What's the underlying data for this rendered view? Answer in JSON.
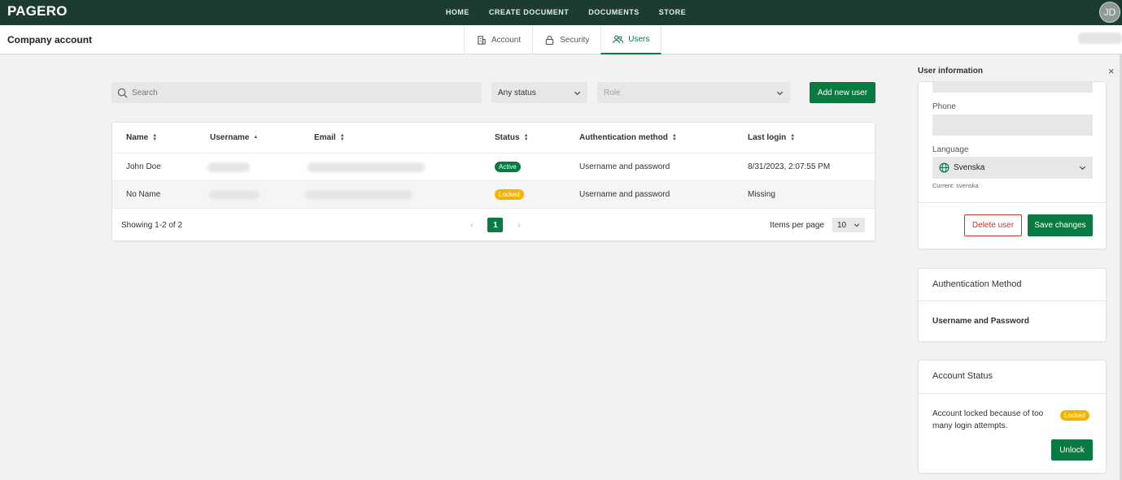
{
  "app": {
    "logo": "PAGERO",
    "avatar_initials": "JD"
  },
  "nav": {
    "items": [
      "HOME",
      "CREATE DOCUMENT",
      "DOCUMENTS",
      "STORE"
    ]
  },
  "subheader": {
    "title": "Company account",
    "tabs": [
      {
        "label": "Account",
        "icon": "building-icon"
      },
      {
        "label": "Security",
        "icon": "lock-icon"
      },
      {
        "label": "Users",
        "icon": "users-icon",
        "active": true
      }
    ]
  },
  "filters": {
    "search_placeholder": "Search",
    "status_value": "Any status",
    "role_placeholder": "Role",
    "add_label": "Add new user"
  },
  "table": {
    "columns": [
      "Name",
      "Username",
      "Email",
      "Status",
      "Authentication method",
      "Last login"
    ],
    "rows": [
      {
        "name": "John Doe",
        "status": "Active",
        "auth": "Username and password",
        "last_login": "8/31/2023, 2:07:55 PM"
      },
      {
        "name": "No Name",
        "status": "Locked",
        "auth": "Username and password",
        "last_login": "Missing"
      }
    ],
    "showing": "Showing 1-2 of 2",
    "current_page": "1",
    "prev": "‹",
    "next": "›",
    "items_per_page_label": "Items per page",
    "items_per_page": "10"
  },
  "panel": {
    "title": "User information",
    "close": "×",
    "phone_label": "Phone",
    "language_label": "Language",
    "language_value": "Svenska",
    "current_language": "Current: svenska",
    "delete_label": "Delete user",
    "save_label": "Save changes",
    "auth_title": "Authentication Method",
    "auth_value": "Username and Password",
    "status_title": "Account Status",
    "status_text_1": "Account locked because of too",
    "status_text_2": "many login attempts.",
    "status_badge": "Locked",
    "unlock_label": "Unlock"
  },
  "colors": {
    "brand_dark": "#1c3b32",
    "accent": "#0a7a43",
    "locked": "#f2b400",
    "danger": "#c0392b"
  }
}
